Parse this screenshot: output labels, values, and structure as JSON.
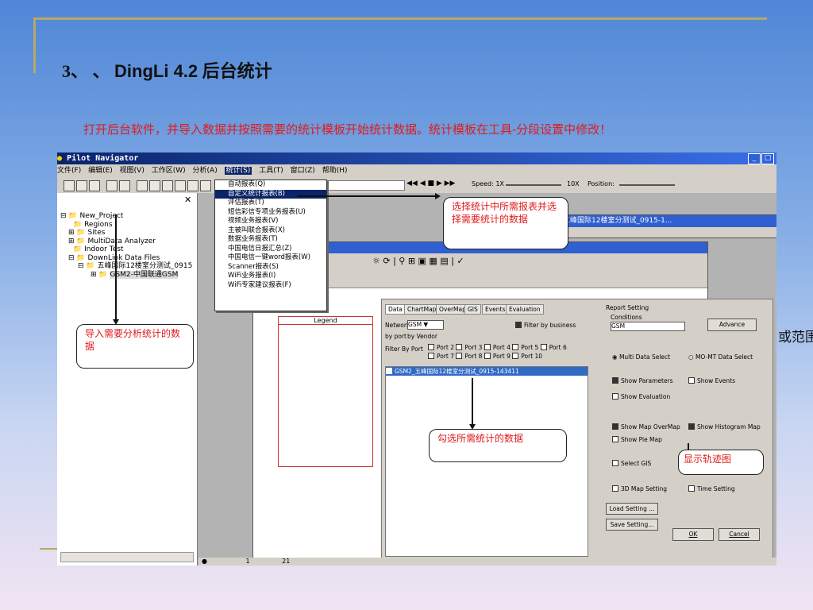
{
  "slide": {
    "title_num": "3、",
    "title_sep": "、",
    "title_app": "DingLi 4.2",
    "title_rest": "后台统计",
    "subtitle": "打开后台软件，并导入数据并按照需要的统计模板开始统计数据。统计模板在工具-分段设置中修改！",
    "edge_text": "或范围"
  },
  "app": {
    "window_title": "Pilot Navigator",
    "menubar": [
      "文件(F)",
      "编辑(E)",
      "视图(V)",
      "工作区(W)",
      "分析(A)",
      "统计(S)",
      "工具(T)",
      "窗口(Z)",
      "帮助(H)"
    ],
    "active_menu_index": 5,
    "toolbar": {
      "speed_label": "Speed:",
      "speed_min": "1X",
      "speed_max": "10X",
      "position_label": "Position:"
    }
  },
  "tree": {
    "items": [
      {
        "label": "New_Project",
        "indent": 0
      },
      {
        "label": "Regions",
        "indent": 1
      },
      {
        "label": "Sites",
        "indent": 1
      },
      {
        "label": "MultiData Analyzer",
        "indent": 1
      },
      {
        "label": "Indoor Test",
        "indent": 1
      },
      {
        "label": "DownLink Data Files",
        "indent": 1
      },
      {
        "label": "五峰国际12楼室分测试_0915",
        "indent": 2
      },
      {
        "label": "GSM2-中国联通GSM",
        "indent": 3
      }
    ]
  },
  "stats_menu": {
    "items": [
      "自动报表(Q)",
      "自定义统计报表(B)",
      "评估报表(T)",
      "短信彩信专项业务报表(U)",
      "视频业务报表(V)",
      "主被叫联合报表(X)",
      "数据业务报表(T)",
      "中国电信日报汇总(Z)",
      "中国电信一键word报表(W)",
      "Scanner报表(S)",
      "WiFi业务报表(I)",
      "WiFi专家建议报表(F)"
    ],
    "highlight_index": 1
  },
  "win2": {
    "title": "五峰国际12楼室分测试_0915-1..."
  },
  "legend": {
    "title": "Legend"
  },
  "dialog": {
    "tabs": [
      "Data",
      "ChartMap",
      "OverMap",
      "GIS",
      "Events",
      "Evaluation"
    ],
    "network_label": "Network:",
    "network_value": "GSM",
    "filter_business": "Filter by business",
    "by_port": "by port",
    "by_vendor": "by Vendor",
    "filter_by_port": "Filter By Port",
    "ports": [
      "Port 2",
      "Port 3",
      "Port 4",
      "Port 5",
      "Port 6",
      "Port 7",
      "Port 8",
      "Port 9",
      "Port 10"
    ],
    "selected_file": "GSM2_五峰国际12楼室分测试_0915-143411",
    "report_setting": "Report Setting",
    "conditions_label": "Conditions",
    "conditions_value": "GSM",
    "advance": "Advance",
    "multi_select": "Multi Data Select",
    "momt_select": "MO-MT Data Select",
    "show_parameters": "Show Parameters",
    "show_events": "Show Events",
    "show_evaluation": "Show Evaluation",
    "show_map_overmap": "Show Map OverMap",
    "show_histogram": "Show Histogram Map",
    "show_pie": "Show Pie Map",
    "select_gis": "Select GIS",
    "map3d": "3D Map Setting",
    "time_setting": "Time Setting",
    "load_setting": "Load Setting ...",
    "save_setting": "Save Setting...",
    "ok": "OK",
    "cancel": "Cancel"
  },
  "status": {
    "a": "1",
    "b": "21"
  },
  "callouts": {
    "import": "导入需要分析统计的数据",
    "choose": "选择统计中所需报表并选择需要统计的数据",
    "check": "勾选所需统计的数据",
    "track": "显示轨迹图"
  }
}
